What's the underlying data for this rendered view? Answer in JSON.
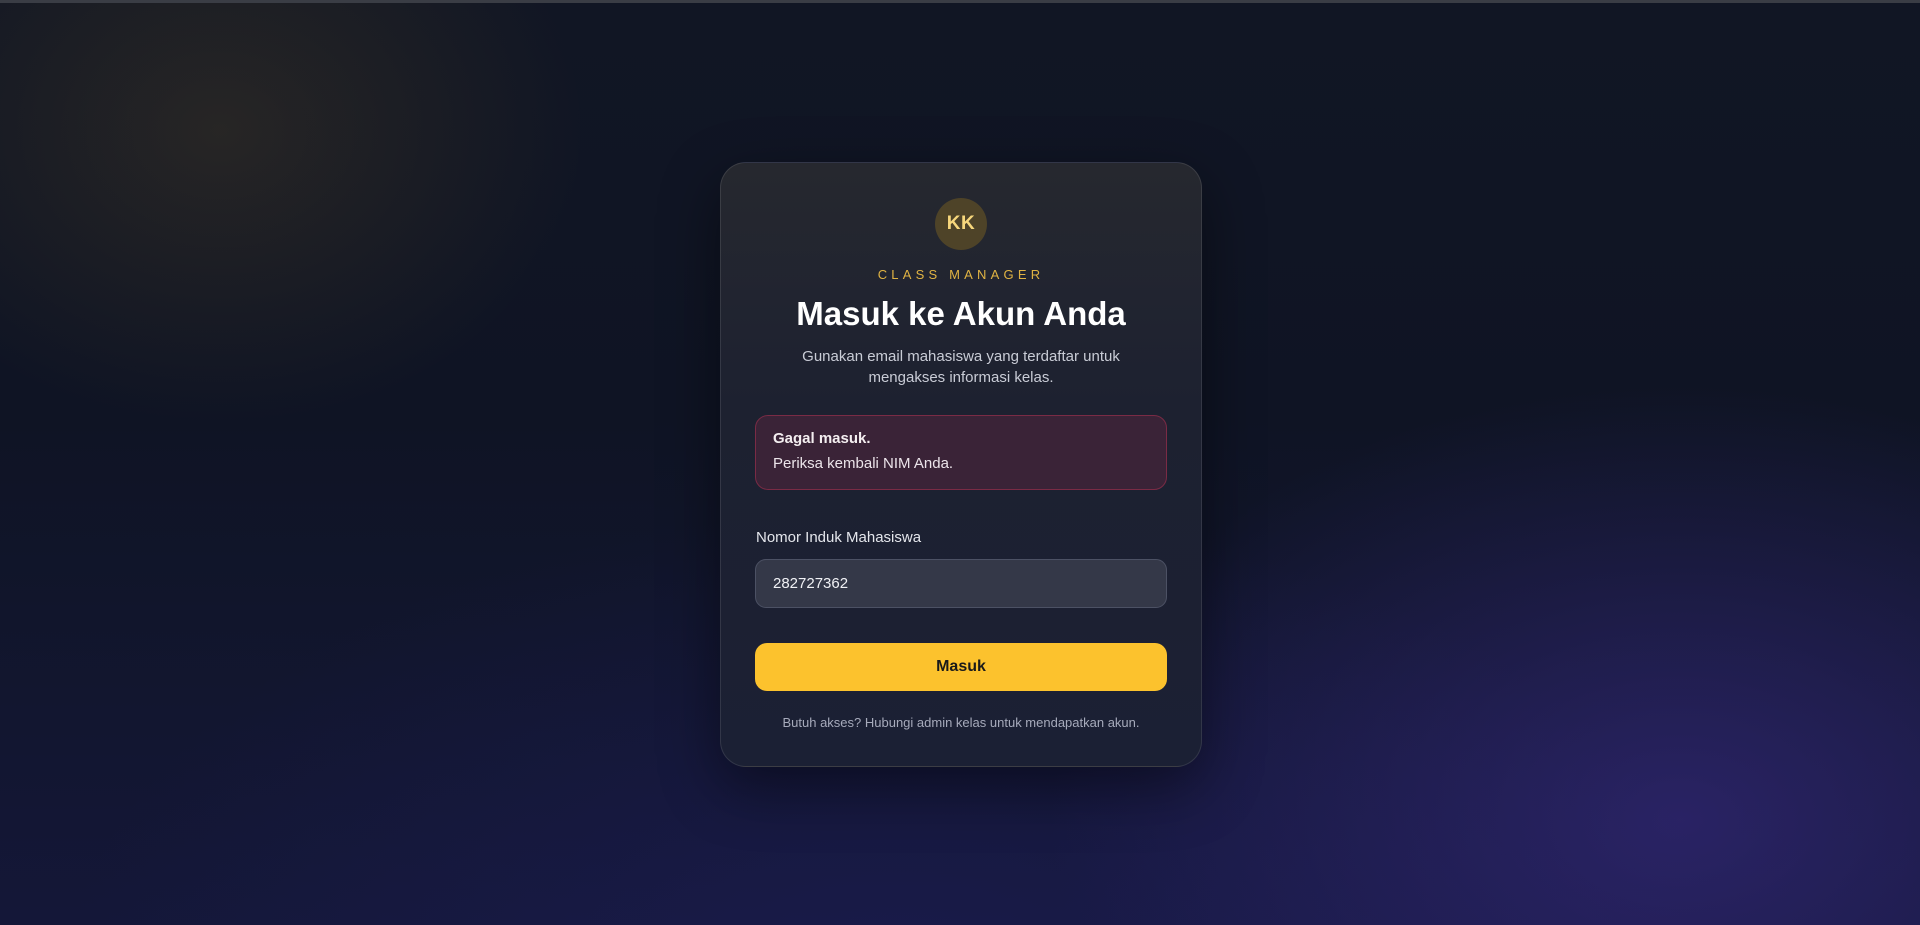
{
  "card": {
    "avatar_initials": "KK",
    "brand": "CLASS MANAGER",
    "title": "Masuk ke Akun Anda",
    "subtitle": "Gunakan email mahasiswa yang terdaftar untuk mengakses informasi kelas."
  },
  "alert": {
    "title": "Gagal masuk.",
    "message": "Periksa kembali NIM Anda."
  },
  "form": {
    "nim_label": "Nomor Induk Mahasiswa",
    "nim_value": "282727362",
    "submit_label": "Masuk"
  },
  "footer": {
    "text": "Butuh akses? Hubungi admin kelas untuk mendapatkan akun."
  },
  "colors": {
    "accent": "#fcc22d",
    "brand_text": "#e0b343",
    "error_border": "#7a2b45",
    "error_bg": "#3a2337"
  }
}
